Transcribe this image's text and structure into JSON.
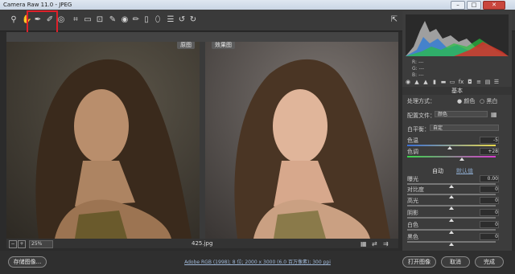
{
  "window": {
    "title": "Camera Raw 11.0 - JPEG",
    "min": "–",
    "max": "□",
    "close": "✕"
  },
  "preview": {
    "before_label": "原图",
    "after_label": "效果图",
    "zoom": "25%",
    "filename": "425.jpg"
  },
  "histogram": {
    "r": "R:",
    "g": "G:",
    "b": "B:",
    "r_val": "---",
    "g_val": "---",
    "b_val": "---"
  },
  "panel": {
    "section": "基本",
    "treatment_label": "处理方式：",
    "treatment_color": "颜色",
    "treatment_bw": "黑白",
    "profile_label": "配置文件：",
    "profile_value": "颜色",
    "wb_label": "白平衡：",
    "wb_value": "自定",
    "auto": "自动",
    "default": "默认值",
    "sliders": [
      {
        "label": "色温",
        "value": "-5",
        "pos": 0.48
      },
      {
        "label": "色调",
        "value": "+28",
        "pos": 0.62
      },
      {
        "label": "曝光",
        "value": "0.00",
        "pos": 0.5
      },
      {
        "label": "对比度",
        "value": "0",
        "pos": 0.5
      },
      {
        "label": "高光",
        "value": "0",
        "pos": 0.5
      },
      {
        "label": "阴影",
        "value": "0",
        "pos": 0.5
      },
      {
        "label": "白色",
        "value": "0",
        "pos": 0.5
      },
      {
        "label": "黑色",
        "value": "0",
        "pos": 0.5
      }
    ]
  },
  "bottom": {
    "save": "存储图像...",
    "info": "Adobe RGB (1998); 8 位; 2000 x 3000 (6.0 百万像素); 300 ppi",
    "open": "打开图像",
    "cancel": "取消",
    "done": "完成"
  },
  "colors": {
    "highlight": "#e0202a",
    "accent": "#9fb8d8"
  }
}
